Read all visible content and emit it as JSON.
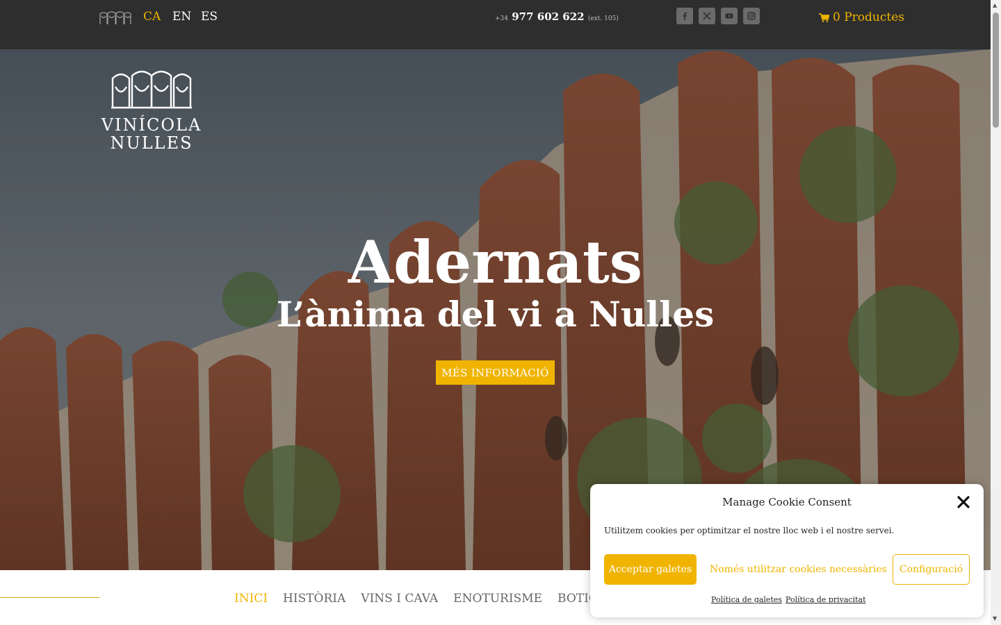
{
  "topbar": {
    "languages": [
      {
        "code": "CA",
        "active": true
      },
      {
        "code": "EN",
        "active": false
      },
      {
        "code": "ES",
        "active": false
      }
    ],
    "phone_prefix": "+34",
    "phone_number": "977 602 622",
    "phone_ext": "(ext. 105)",
    "social_icons": [
      "facebook-icon",
      "x-icon",
      "youtube-icon",
      "instagram-icon"
    ],
    "cart_label": "0 Productes"
  },
  "logo": {
    "line1": "VINÍCOLA",
    "line2": "NULLES"
  },
  "hero": {
    "title": "Adernats",
    "subtitle": "L’ànima del vi a Nulles",
    "button_label": "MÉS INFORMACIÓ"
  },
  "nav": {
    "items": [
      "INICI",
      "HISTÒRIA",
      "VINS I CAVA",
      "ENOTURISME",
      "BOTIGA ON-LINE"
    ],
    "active_index": 0
  },
  "cookie": {
    "title": "Manage Cookie Consent",
    "text": "Utilitzem cookies per optimitzar el nostre lloc web i el nostre servei.",
    "accept_label": "Acceptar galetes",
    "necessary_label": "Només utilitzar cookies necessàries",
    "config_label": "Configuració",
    "link_cookies": "Política de galetes",
    "link_privacy": "Política de privacitat"
  },
  "colors": {
    "accent": "#f0b400",
    "topbar": "#2e2e2e",
    "nav_text": "#666666"
  }
}
